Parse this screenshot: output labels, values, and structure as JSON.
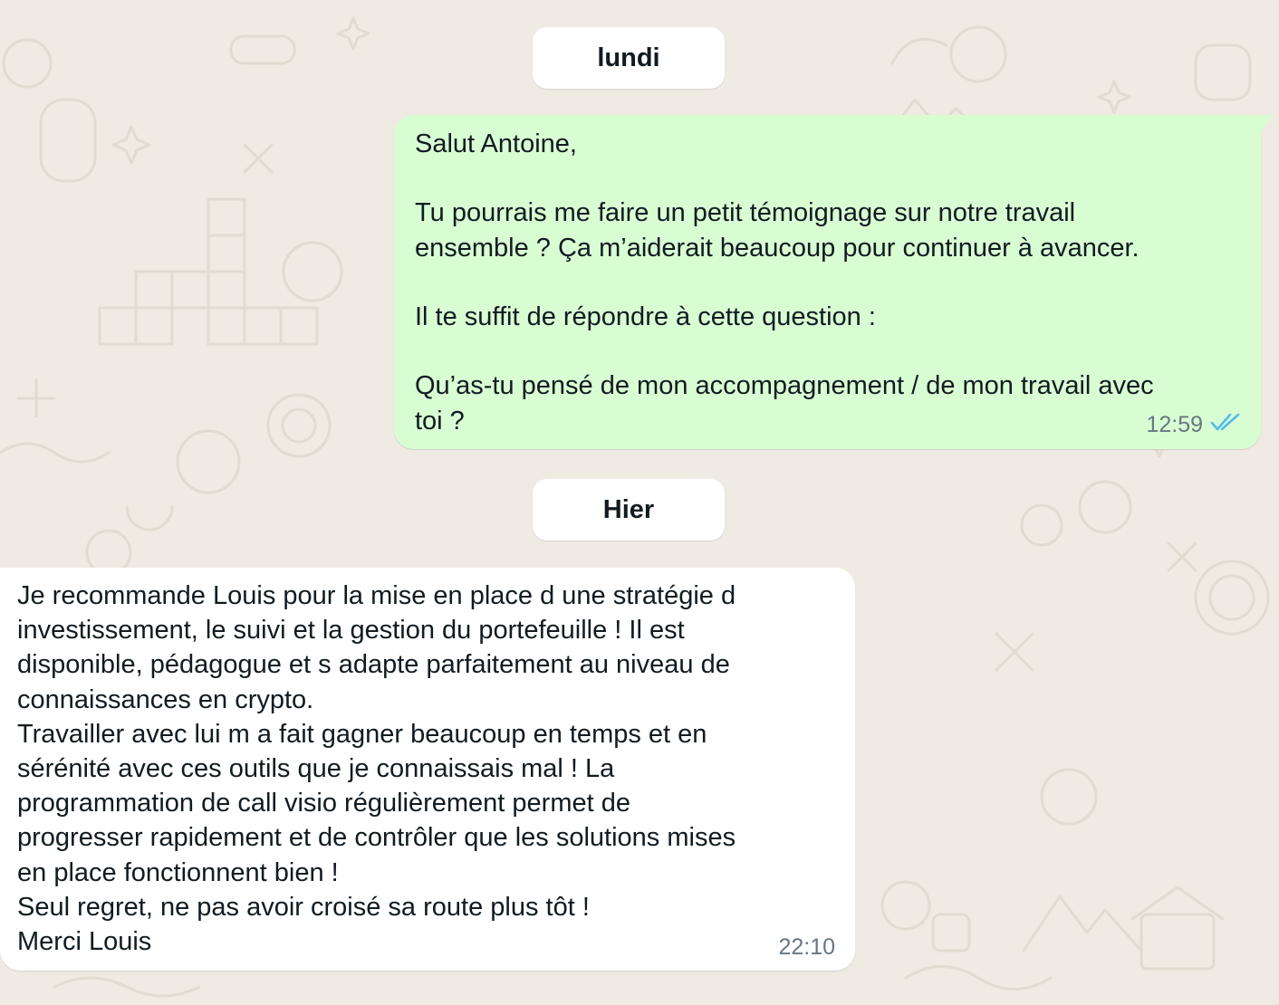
{
  "conversation": {
    "date_separators": {
      "first": "lundi",
      "second": "Hier"
    },
    "outgoing_message": {
      "lines": [
        "Salut Antoine,",
        "",
        "Tu pourrais me faire un petit témoignage sur notre travail",
        "ensemble ? Ça m’aiderait beaucoup pour continuer à avancer.",
        "",
        "Il te suffit de répondre à cette question :",
        "",
        "Qu’as-tu pensé de mon accompagnement / de mon travail avec",
        "toi ?"
      ],
      "time": "12:59",
      "status_icon": "double-check-read-icon",
      "bubble_color": "#d9fdd3",
      "tick_color": "#53bdeb"
    },
    "incoming_message": {
      "lines": [
        "Je recommande Louis pour la mise en place d une stratégie d",
        "investissement, le suivi et la gestion du portefeuille ! Il est",
        "disponible, pédagogue et s adapte parfaitement au niveau de",
        "connaissances en crypto.",
        "Travailler avec lui m a fait gagner beaucoup en temps et en",
        "sérénité avec ces outils que je connaissais mal ! La",
        "programmation de call visio régulièrement permet de",
        "progresser rapidement et de contrôler que les solutions mises",
        "en place fonctionnent bien !",
        "Seul regret, ne pas avoir croisé sa route plus tôt !",
        "Merci Louis"
      ],
      "time": "22:10",
      "bubble_color": "#ffffff"
    },
    "wallpaper_color": "#efeae2"
  }
}
